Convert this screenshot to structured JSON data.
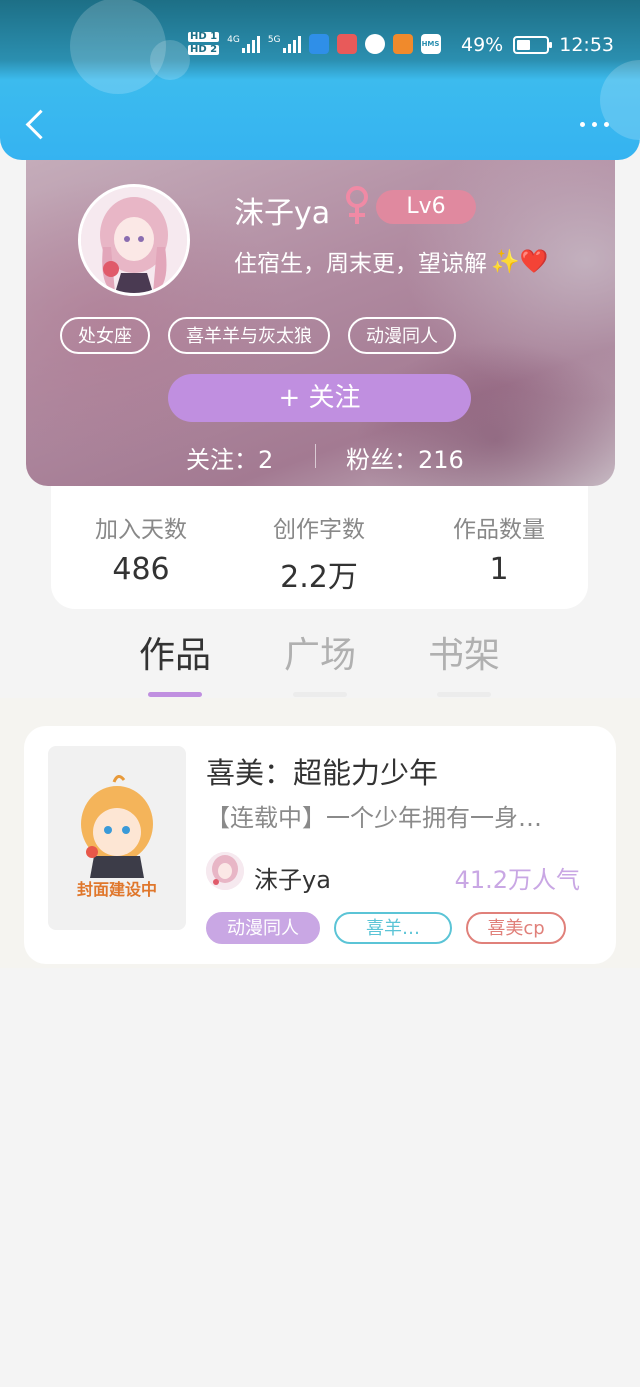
{
  "status_bar": {
    "hd1": "HD 1",
    "hd2": "HD 2",
    "net1": "4G",
    "net2": "5G",
    "app_icons": [
      "app-icon-blue",
      "app-icon-red",
      "app-icon-globe",
      "app-icon-orange",
      "hms-icon"
    ],
    "hms": "HMS",
    "battery": "49%",
    "time": "12:53"
  },
  "header": {
    "back_icon": "chevron-left-icon",
    "more_icon": "more-dots-icon"
  },
  "profile": {
    "username": "沫子ya",
    "gender_icon": "female-icon",
    "level": "Lv6",
    "signature": "住宿生，周末更，望谅解",
    "signature_emoji": "✨❤️",
    "tags": [
      "处女座",
      "喜羊羊与灰太狼",
      "动漫同人"
    ],
    "follow_button": "+ 关注",
    "following_label": "关注：2",
    "fans_label": "粉丝：216"
  },
  "stats": [
    {
      "label": "加入天数",
      "value": "486"
    },
    {
      "label": "创作字数",
      "value": "2.2万"
    },
    {
      "label": "作品数量",
      "value": "1"
    }
  ],
  "tabs": [
    {
      "label": "作品",
      "active": true
    },
    {
      "label": "广场",
      "active": false
    },
    {
      "label": "书架",
      "active": false
    }
  ],
  "work": {
    "cover_caption": "封面建设中",
    "title": "喜美：超能力少年",
    "description": "【连载中】一个少年拥有一身…",
    "author": "沫子ya",
    "popularity": "41.2万人气",
    "tags": [
      "动漫同人",
      "喜羊…",
      "喜美cp"
    ]
  },
  "colors": {
    "accent_purple": "#c08fe0",
    "header_blue": "#35b3f1",
    "level_pink": "#e0899f",
    "tag_cyan": "#5bc4d6",
    "tag_red": "#e0807a"
  }
}
